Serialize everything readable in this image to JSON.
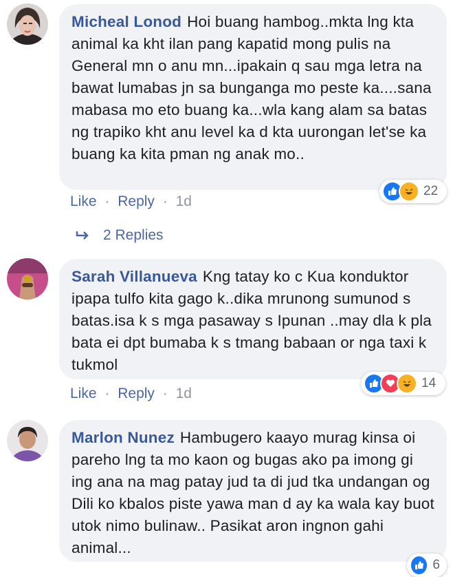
{
  "comments": [
    {
      "author": "Micheal Lonod",
      "text": "Hoi buang hambog..mkta lng kta animal ka kht ilan pang kapatid mong pulis na General mn o anu mn...ipakain q sau mga letra na bawat lumabas jn sa bunganga mo peste ka....sana mabasa mo eto buang ka...wla kang alam sa batas ng trapiko kht anu level ka d kta uurongan let'se ka buang ka kita pman ng anak mo..",
      "reaction_count": "22",
      "like_label": "Like",
      "reply_label": "Reply",
      "time": "1d",
      "replies_label": "2 Replies"
    },
    {
      "author": "Sarah Villanueva",
      "text": "Kng tatay ko c Kua konduktor ipapa tulfo kita gago k..dika mrunong sumunod s batas.isa k s mga pasaway s Ipunan ..may dla k pla bata ei dpt bumaba k s tmang babaan or nga taxi k tukmol",
      "reaction_count": "14",
      "like_label": "Like",
      "reply_label": "Reply",
      "time": "1d"
    },
    {
      "author": "Marlon Nunez",
      "text": "Hambugero kaayo murag kinsa oi pareho lng ta mo kaon og bugas ako pa imong gi ing ana na mag patay jud ta di jud tka undangan og Dili ko kbalos piste yawa man d ay ka wala kay buot utok nimo bulinaw.. Pasikat aron ingnon gahi animal...",
      "reaction_count": "6"
    }
  ],
  "separator": "·",
  "colors": {
    "like_blue": "#1877f2",
    "love_red": "#f33e58",
    "haha_yellow": "#f7b125",
    "author_blue": "#385898",
    "bubble_gray": "#f0f2f5"
  }
}
